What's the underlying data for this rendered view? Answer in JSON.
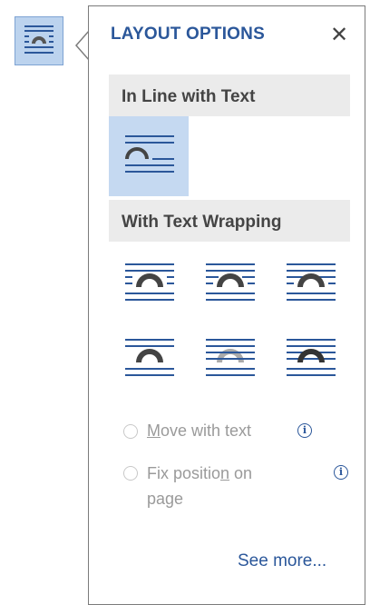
{
  "icons": {
    "anchor": "layout-options-icon",
    "close": "close-icon",
    "info": "info-icon"
  },
  "colors": {
    "accent": "#2b579a",
    "selected_bg": "#c5d9f1",
    "section_bg": "#ebebeb"
  },
  "panel": {
    "title": "LAYOUT OPTIONS",
    "close_label": "✕"
  },
  "sections": {
    "inline": {
      "label": "In Line with Text"
    },
    "wrapping": {
      "label": "With Text Wrapping"
    }
  },
  "options": {
    "inline": [
      {
        "name": "In Line with Text",
        "selected": true
      }
    ],
    "wrapping": [
      {
        "name": "Square"
      },
      {
        "name": "Tight"
      },
      {
        "name": "Through"
      },
      {
        "name": "Top and Bottom"
      },
      {
        "name": "Behind Text"
      },
      {
        "name": "In Front of Text"
      }
    ]
  },
  "radios": {
    "move_with_text": {
      "label": "Move with text",
      "mnemonic": "M",
      "rest": "ove with text",
      "checked": false,
      "enabled": false
    },
    "fix_position": {
      "line1_pre": "Fix positio",
      "mnemonic": "n",
      "line1_post": " on",
      "line2": "page",
      "checked": false,
      "enabled": false
    }
  },
  "info_glyph": "i",
  "see_more": "See more..."
}
